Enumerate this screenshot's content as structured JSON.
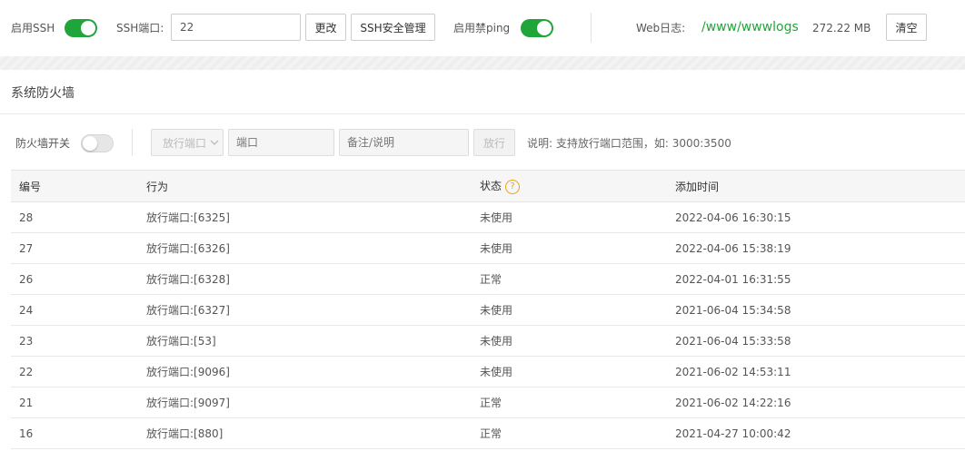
{
  "topbar": {
    "ssh_enable_label": "启用SSH",
    "ssh_port_label": "SSH端口:",
    "ssh_port_value": "22",
    "change_button": "更改",
    "ssh_security_button": "SSH安全管理",
    "ping_disable_label": "启用禁ping",
    "web_log_label": "Web日志:",
    "web_log_path": "/www/wwwlogs",
    "web_log_size": "272.22 MB",
    "clear_button": "清空"
  },
  "firewall": {
    "section_title": "系统防火墙",
    "switch_label": "防火墙开关",
    "action_select_value": "放行端口",
    "port_placeholder": "端口",
    "remark_placeholder": "备注/说明",
    "allow_button": "放行",
    "hint": "说明: 支持放行端口范围，如: 3000:3500"
  },
  "table": {
    "headers": {
      "id": "编号",
      "action": "行为",
      "status": "状态",
      "added_time": "添加时间"
    },
    "help_symbol": "?",
    "rows": [
      {
        "id": "28",
        "action": "放行端口:[6325]",
        "status": "未使用",
        "time": "2022-04-06 16:30:15"
      },
      {
        "id": "27",
        "action": "放行端口:[6326]",
        "status": "未使用",
        "time": "2022-04-06 15:38:19"
      },
      {
        "id": "26",
        "action": "放行端口:[6328]",
        "status": "正常",
        "time": "2022-04-01 16:31:55"
      },
      {
        "id": "24",
        "action": "放行端口:[6327]",
        "status": "未使用",
        "time": "2021-06-04 15:34:58"
      },
      {
        "id": "23",
        "action": "放行端口:[53]",
        "status": "未使用",
        "time": "2021-06-04 15:33:58"
      },
      {
        "id": "22",
        "action": "放行端口:[9096]",
        "status": "未使用",
        "time": "2021-06-02 14:53:11"
      },
      {
        "id": "21",
        "action": "放行端口:[9097]",
        "status": "正常",
        "time": "2021-06-02 14:22:16"
      },
      {
        "id": "16",
        "action": "放行端口:[880]",
        "status": "正常",
        "time": "2021-04-27 10:00:42"
      }
    ]
  },
  "colors": {
    "accent": "#20a53a",
    "help": "#f0a30a"
  },
  "toggles": {
    "ssh_enabled": true,
    "ping_disabled": true,
    "firewall_enabled": false
  }
}
